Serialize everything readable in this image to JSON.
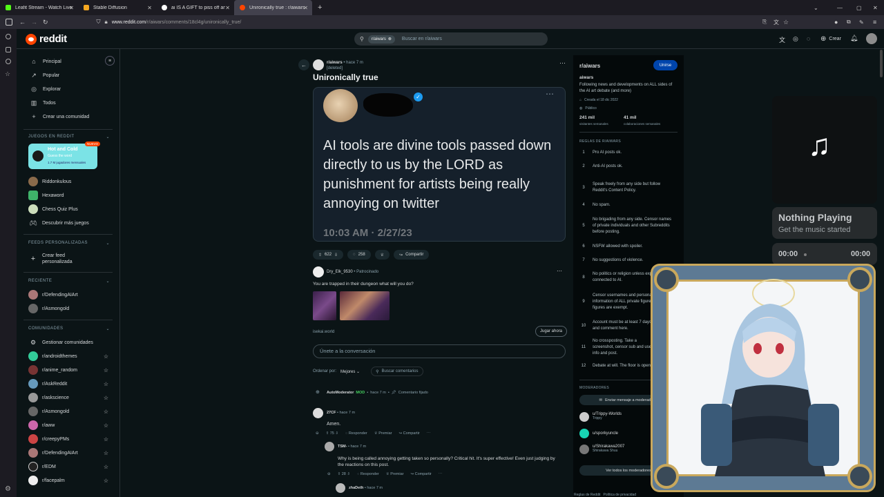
{
  "browser": {
    "tabs": [
      {
        "title": "Leafit Stream - Watch Live",
        "color": "#53fc18"
      },
      {
        "title": "Stable Diffusion",
        "color": "#f6a821"
      },
      {
        "title": "ai IS A GIFT to piss off artists - ...",
        "color": "#ffffff"
      },
      {
        "title": "Unironically true : r/aiwars",
        "color": "#ff4500"
      }
    ],
    "url_domain": "www.reddit.com",
    "url_path": "/r/aiwars/comments/18cl4g/unironically_true/"
  },
  "header": {
    "logo_text": "reddit",
    "search_chip": "r/aiwars",
    "search_placeholder": "Buscar en r/aiwars",
    "create_label": "Crear"
  },
  "leftnav": {
    "main": [
      {
        "label": "Principal",
        "icon": "home-icon",
        "glyph": "⌂"
      },
      {
        "label": "Popular",
        "icon": "popular-icon",
        "glyph": "↗"
      },
      {
        "label": "Explorar",
        "icon": "explore-icon",
        "glyph": "◎"
      },
      {
        "label": "Todos",
        "icon": "all-icon",
        "glyph": "▥"
      },
      {
        "label": "Crear una comunidad",
        "icon": "plus-icon",
        "glyph": "+"
      }
    ],
    "games_title": "JUEGOS EN REDDIT",
    "featured_game": {
      "name": "Hot and Cold",
      "sub": "Guess the word",
      "players": "1.7 M jugadores mensuales",
      "badge": "NUEVO"
    },
    "games": [
      "Riddonkulous",
      "Hexaword",
      "Chess Quiz Plus",
      "Descubrir más juegos"
    ],
    "feeds_title": "FEEDS PERSONALIZADAS",
    "create_feed": "Crear feed personalizada",
    "recent_title": "RECIENTE",
    "recent": [
      "r/DefendingAIArt",
      "r/Asmongold"
    ],
    "communities_title": "COMUNIDADES",
    "manage": "Gestionar comunidades",
    "communities": [
      "r/androidthemes",
      "r/anime_random",
      "r/AskReddit",
      "r/askscience",
      "r/Asmongold",
      "r/aww",
      "r/creepyPMs",
      "r/DefendingAIArt",
      "r/EDM",
      "r/facepalm"
    ]
  },
  "post": {
    "subreddit": "r/aiwars",
    "time": "hace 7 m",
    "author": "[deleted]",
    "title": "Unironically true",
    "tweet_text": "AI tools are divine tools passed down directly to us by the LORD as punishment for artists being really annoying on twitter",
    "tweet_time": "10:03 AM · 2/27/23",
    "votes": "622",
    "comments": "258",
    "share": "Compartir"
  },
  "ad": {
    "author": "Dry_Elk_9530",
    "label": "Patrocinado",
    "text": "You are trapped in their dungeon what will you do?",
    "domain": "isekai.world",
    "cta": "Jugar ahora"
  },
  "join_placeholder": "Únete a la conversación",
  "sort": {
    "label": "Ordenar por:",
    "value": "Mejores",
    "search": "Buscar comentarios"
  },
  "comments": [
    {
      "author": "AutoModerator",
      "mod": "MOD",
      "time": "hace 7 m",
      "pinned": "Comentario fijado"
    },
    {
      "author": "27CF",
      "time": "hace 7 m",
      "text": "Amen.",
      "votes": "75",
      "reply": "Responder",
      "award": "Premiar",
      "share": "Compartir"
    },
    {
      "author": "TSM-",
      "time": "hace 7 m",
      "text": "Why is being called annoying getting taken so personally? Critical hit. It's super effective! Even just judging by the reactions on this post.",
      "votes": "28",
      "reply": "Responder",
      "award": "Premiar",
      "share": "Compartir"
    },
    {
      "author": "zhaDeth",
      "time": "hace 7 m"
    }
  ],
  "rsidebar": {
    "name": "r/aiwars",
    "join": "Unirse",
    "title": "aiwars",
    "desc": "Following news and developments on ALL sides of the AI art debate (and more)",
    "created": "Creada el 18 dic 2022",
    "public": "Público",
    "visitors": "241 mil",
    "visitors_label": "visitantes semanales",
    "contribs": "41 mil",
    "contribs_label": "colaboraciones semanales",
    "rules_title": "REGLAS DE R/AIWARS",
    "rules": [
      "Pro AI posts ok.",
      "Anti-AI posts ok.",
      "Speak freely from any side but follow Reddit's Content Policy.",
      "No spam.",
      "No brigading from any side. Censor names of private individuals and other Subreddits before posting.",
      "NSFW allowed with spoiler.",
      "No suggestions of violence.",
      "No politics or religion unless explicitly connected to AI.",
      "Censor usernames and personal information of ALL private figures. Public figures are exempt.",
      "Account must be at least 7 days old to post and comment here.",
      "No crossposting. Take a screenshot, censor sub and user info and post.",
      "Debate at will. The floor is open."
    ],
    "mods_title": "MODERADORES",
    "message_mods": "Enviar mensaje a moderadores",
    "mods": [
      {
        "name": "u/Trippy-Worlds",
        "flair": "Trippy"
      },
      {
        "name": "u/sporkyuncle",
        "flair": ""
      },
      {
        "name": "u/Shirakawa2007",
        "flair": "Shirakawa Shuu"
      }
    ],
    "all_mods": "Ver todos los moderadores",
    "footer": "Reglas de Reddit   Política de privacidad"
  },
  "music": {
    "status": "Nothing Playing",
    "sub": "Get the music started",
    "elapsed": "00:00",
    "total": "00:00"
  }
}
